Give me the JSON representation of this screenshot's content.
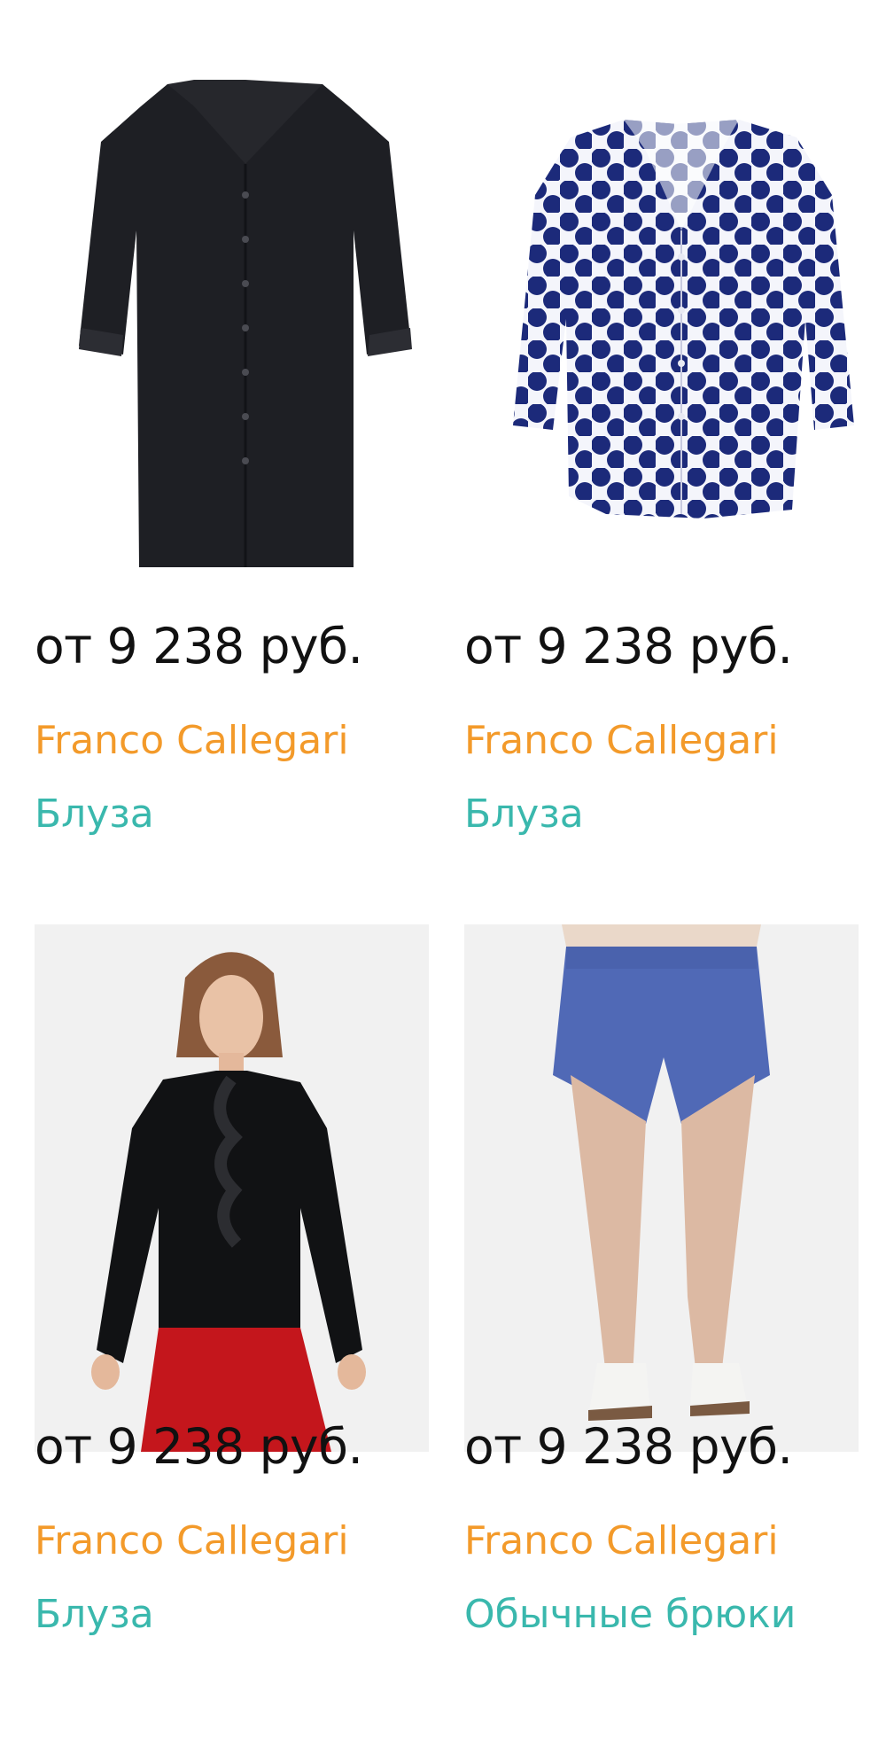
{
  "products": [
    {
      "price": "от 9 238 руб.",
      "brand": "Franco Callegari",
      "type": "Блуза",
      "image": "black-tunic-shirt"
    },
    {
      "price": "от 9 238 руб.",
      "brand": "Franco Callegari",
      "type": "Блуза",
      "image": "navy-polka-dot-blouse"
    },
    {
      "price": "от 9 238 руб.",
      "brand": "Franco Callegari",
      "type": "Блуза",
      "image": "model-black-ruffle-blouse"
    },
    {
      "price": "от 9 238 руб.",
      "brand": "Franco Callegari",
      "type": "Обычные брюки",
      "image": "model-blue-shorts"
    }
  ],
  "colors": {
    "price": "#111111",
    "brand": "#f39a2a",
    "type": "#3ab8ad",
    "photo_bg": "#f1f1f1"
  }
}
